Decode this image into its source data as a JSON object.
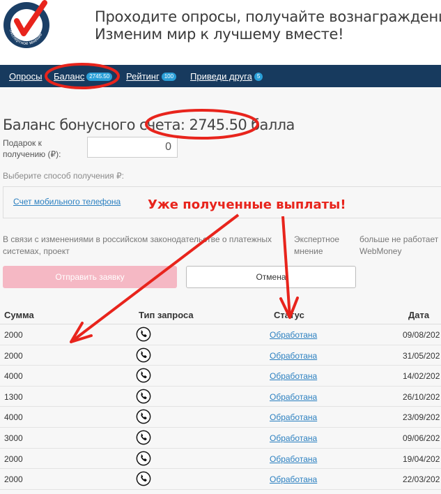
{
  "header": {
    "logo_text": "Экспертное мнение",
    "tagline_line1": "Проходите опросы, получайте вознаграждение.",
    "tagline_line2": "Изменим мир к лучшему вместе!"
  },
  "nav": {
    "items": [
      {
        "label": "Опросы",
        "badge": ""
      },
      {
        "label": "Баланс",
        "badge": "2745.50"
      },
      {
        "label": "Рейтинг",
        "badge": "100"
      },
      {
        "label": "Приведи друга",
        "badge": "5"
      }
    ]
  },
  "balance": {
    "title": "Баланс бонусного счета: 2745.50 балла"
  },
  "form": {
    "gift_label": "Подарок к получению (₽):",
    "gift_value": "0",
    "method_label": "Выберите способ получения ₽:",
    "method_option": "Счет мобильного телефона"
  },
  "notice": {
    "part1": "В связи с изменениями в российском законодательстве о платежных системах, проект",
    "part2": "Экспертное мнение",
    "part3": "больше не работает с WebMoney"
  },
  "buttons": {
    "send": "Отправить заявку",
    "cancel": "Отмена"
  },
  "annotation": "Уже полученные выплаты!",
  "table": {
    "headers": [
      "Сумма",
      "Тип запроса",
      "Статус",
      "Дата"
    ],
    "rows": [
      {
        "sum": "2000",
        "type_icon": "phone-icon",
        "status": "Обработана",
        "date": "09/08/202"
      },
      {
        "sum": "2000",
        "type_icon": "phone-icon",
        "status": "Обработана",
        "date": "31/05/202"
      },
      {
        "sum": "4000",
        "type_icon": "phone-icon",
        "status": "Обработана",
        "date": "14/02/202"
      },
      {
        "sum": "1300",
        "type_icon": "phone-icon",
        "status": "Обработана",
        "date": "26/10/202"
      },
      {
        "sum": "4000",
        "type_icon": "phone-icon",
        "status": "Обработана",
        "date": "23/09/202"
      },
      {
        "sum": "3000",
        "type_icon": "phone-icon",
        "status": "Обработана",
        "date": "09/06/202"
      },
      {
        "sum": "2000",
        "type_icon": "phone-icon",
        "status": "Обработана",
        "date": "19/04/202"
      },
      {
        "sum": "2000",
        "type_icon": "phone-icon",
        "status": "Обработана",
        "date": "22/03/202"
      }
    ]
  },
  "colors": {
    "nav_bg": "#173a5e",
    "badge_bg": "#2a9fd8",
    "link": "#2a7fc0",
    "annotation_red": "#e8241c",
    "send_button": "#f5b8c4"
  }
}
